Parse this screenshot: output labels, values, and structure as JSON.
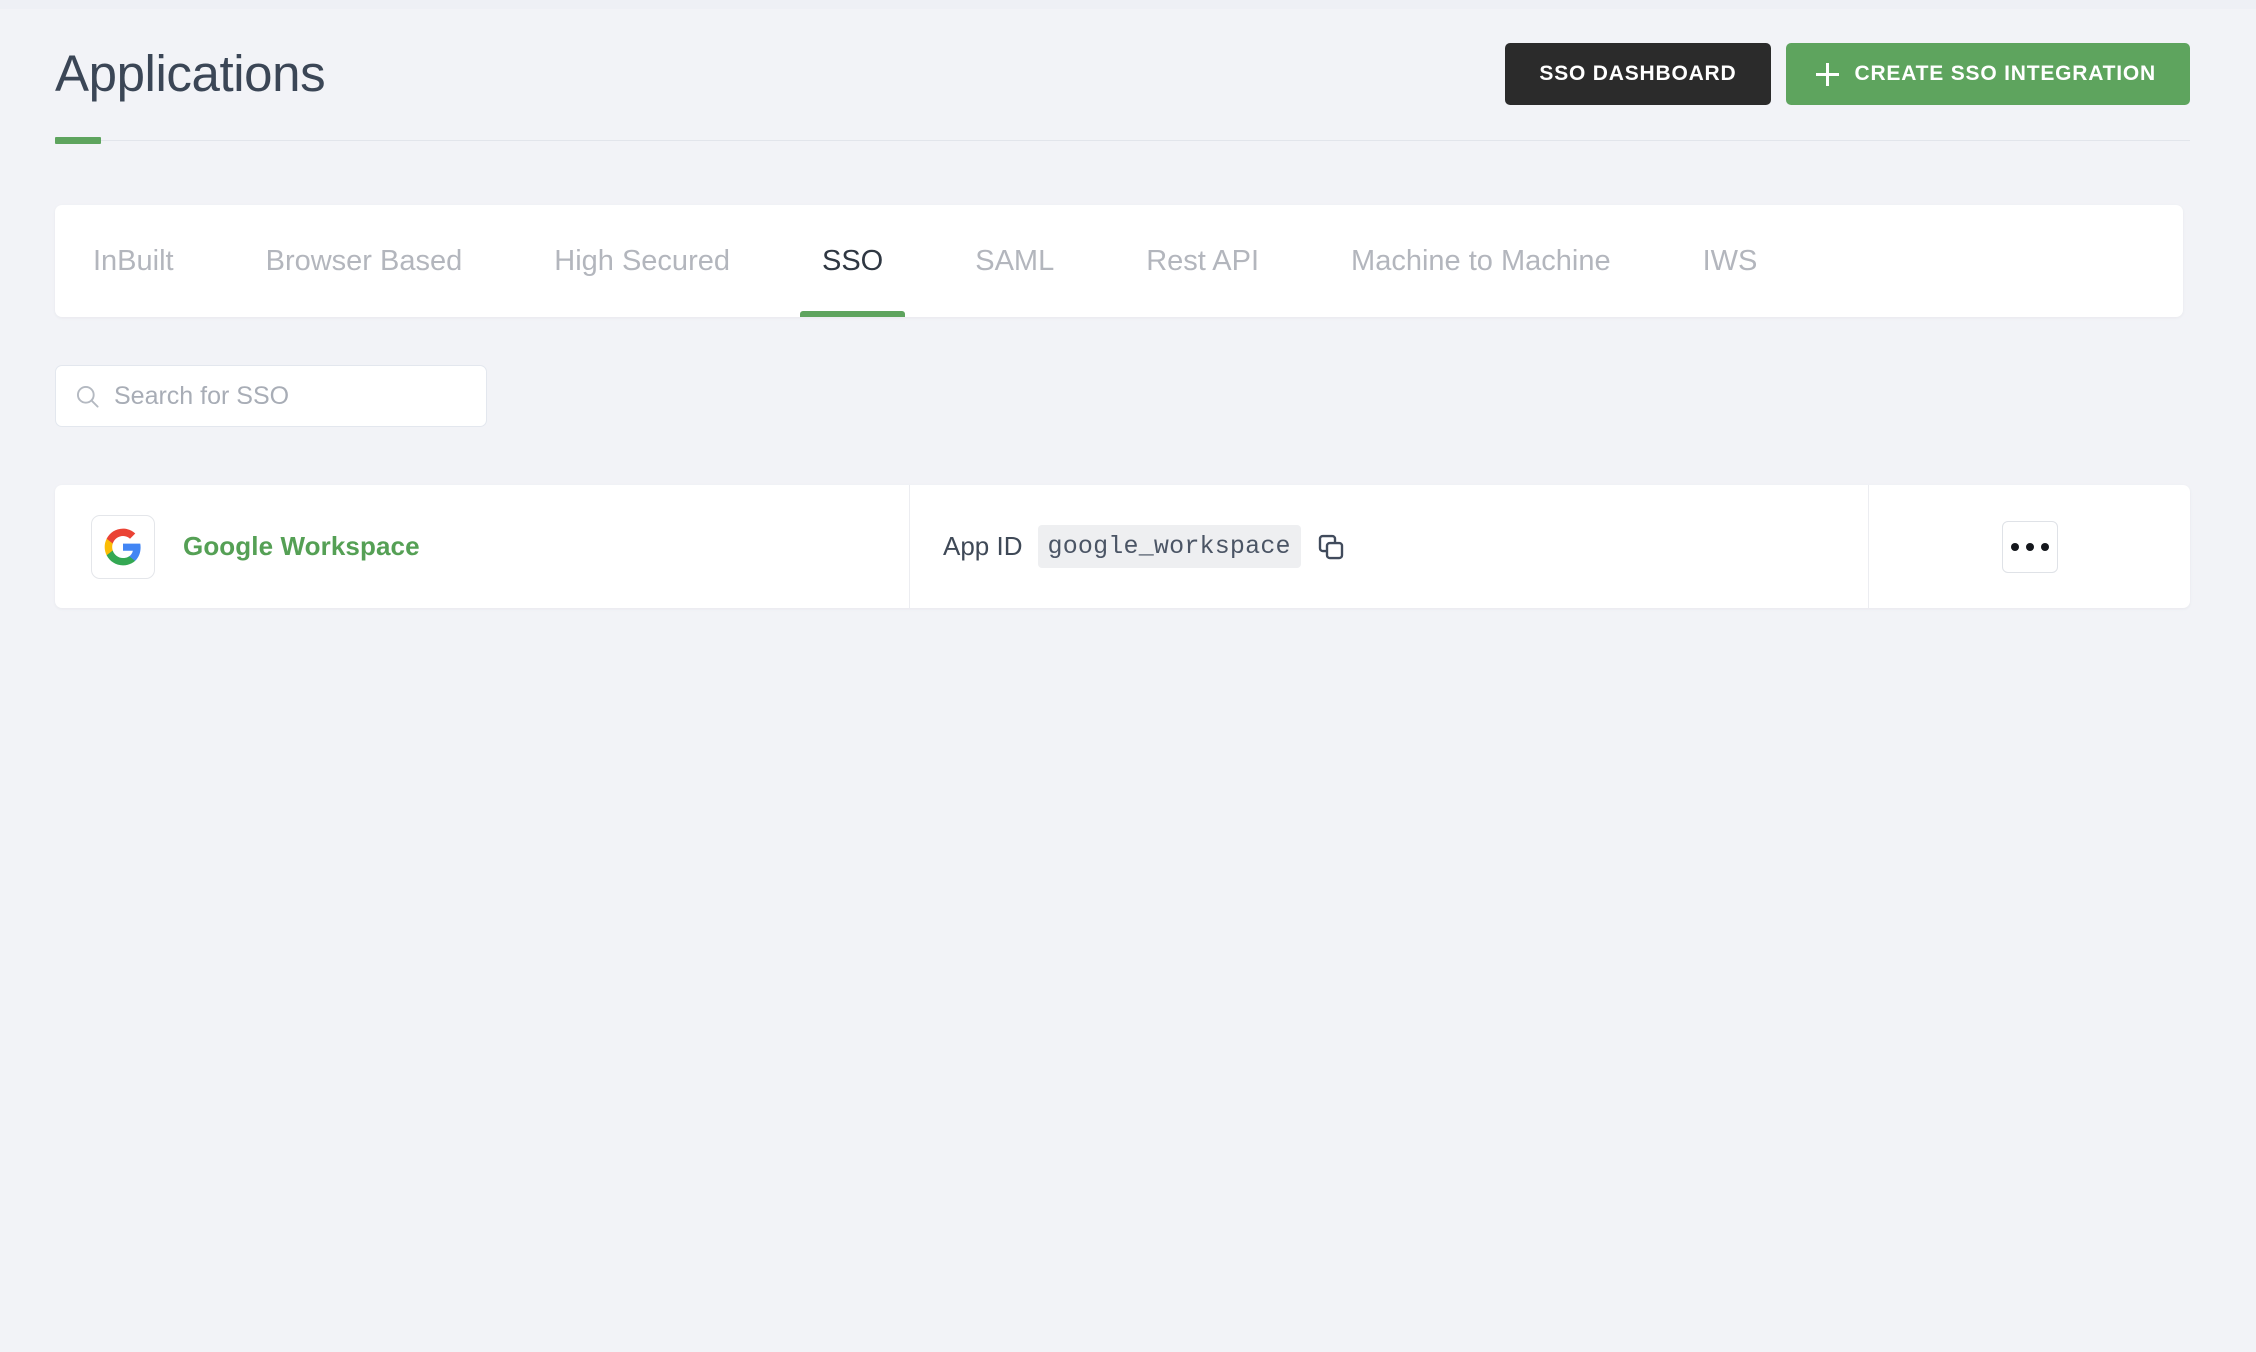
{
  "page": {
    "title": "Applications",
    "accent_color": "#5ea45e",
    "background_color": "#f2f3f7"
  },
  "header": {
    "buttons": [
      {
        "label": "SSO DASHBOARD",
        "name": "sso-dashboard-button",
        "color": "#2b2b2b"
      },
      {
        "label": "CREATE SSO INTEGRATION",
        "name": "create-sso-integration-button",
        "color": "#5ea45e",
        "icon": "plus-icon"
      }
    ]
  },
  "tabs": {
    "items": [
      {
        "label": "InBuilt",
        "active": false
      },
      {
        "label": "Browser Based",
        "active": false
      },
      {
        "label": "High Secured",
        "active": false
      },
      {
        "label": "SSO",
        "active": true
      },
      {
        "label": "SAML",
        "active": false
      },
      {
        "label": "Rest API",
        "active": false
      },
      {
        "label": "Machine to Machine",
        "active": false
      },
      {
        "label": "IWS",
        "active": false
      }
    ],
    "active_index": 3
  },
  "search": {
    "placeholder": "Search for SSO",
    "value": "",
    "icon": "search-icon"
  },
  "list": {
    "appid_label": "App ID",
    "rows": [
      {
        "name": "Google Workspace",
        "logo": "google-logo-icon",
        "app_id": "google_workspace",
        "copy_icon": "copy-icon",
        "menu_icon": "kebab-menu-icon"
      }
    ]
  }
}
